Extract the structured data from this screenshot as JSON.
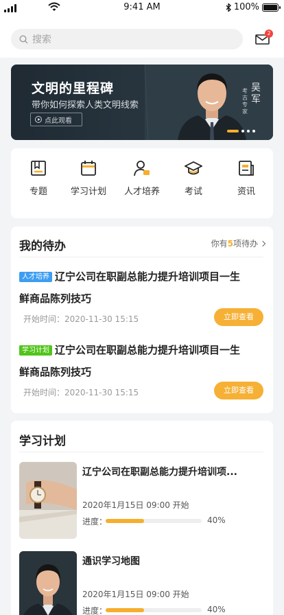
{
  "status": {
    "time": "9:41 AM",
    "battery": "100%"
  },
  "header": {
    "search_placeholder": "搜索",
    "mail_badge": "2"
  },
  "banner": {
    "title": "文明的里程碑",
    "subtitle": "带你如何探索人类文明线索",
    "watch_label": "点此观看",
    "expert_name": "吴军",
    "expert_title": "考古专家"
  },
  "menu": [
    {
      "label": "专题",
      "icon": "topic-icon"
    },
    {
      "label": "学习计划",
      "icon": "calendar-icon"
    },
    {
      "label": "人才培养",
      "icon": "talent-icon"
    },
    {
      "label": "考试",
      "icon": "exam-cap-icon"
    },
    {
      "label": "资讯",
      "icon": "news-icon"
    }
  ],
  "todo": {
    "title": "我的待办",
    "count_prefix": "你有",
    "count": "5",
    "count_suffix": "项待办",
    "items": [
      {
        "tag": "人才培养",
        "title": "辽宁公司在职副总能力提升培训项目一生鲜商品陈列技巧",
        "time": "开始时间：2020-11-30 15:15",
        "button": "立即查看"
      },
      {
        "tag": "学习计划",
        "title": "辽宁公司在职副总能力提升培训项目一生鲜商品陈列技巧",
        "time": "开始时间：2020-11-30 15:15",
        "button": "立即查看"
      }
    ]
  },
  "plan": {
    "title": "学习计划",
    "items": [
      {
        "title": "辽宁公司在职副总能力提升培训项...",
        "date": "2020年1月15日 09:00 开始",
        "progress_label": "进度：",
        "progress": 0.4,
        "progress_text": "40%"
      },
      {
        "title": "通识学习地图",
        "date": "2020年1月15日 09:00 开始",
        "progress_label": "进度：",
        "progress": 0.4,
        "progress_text": "40%"
      }
    ]
  },
  "colors": {
    "accent": "#f6ae2d",
    "tag_blue": "#3d9df2",
    "tag_green": "#52c41a",
    "badge": "#f5413d"
  }
}
